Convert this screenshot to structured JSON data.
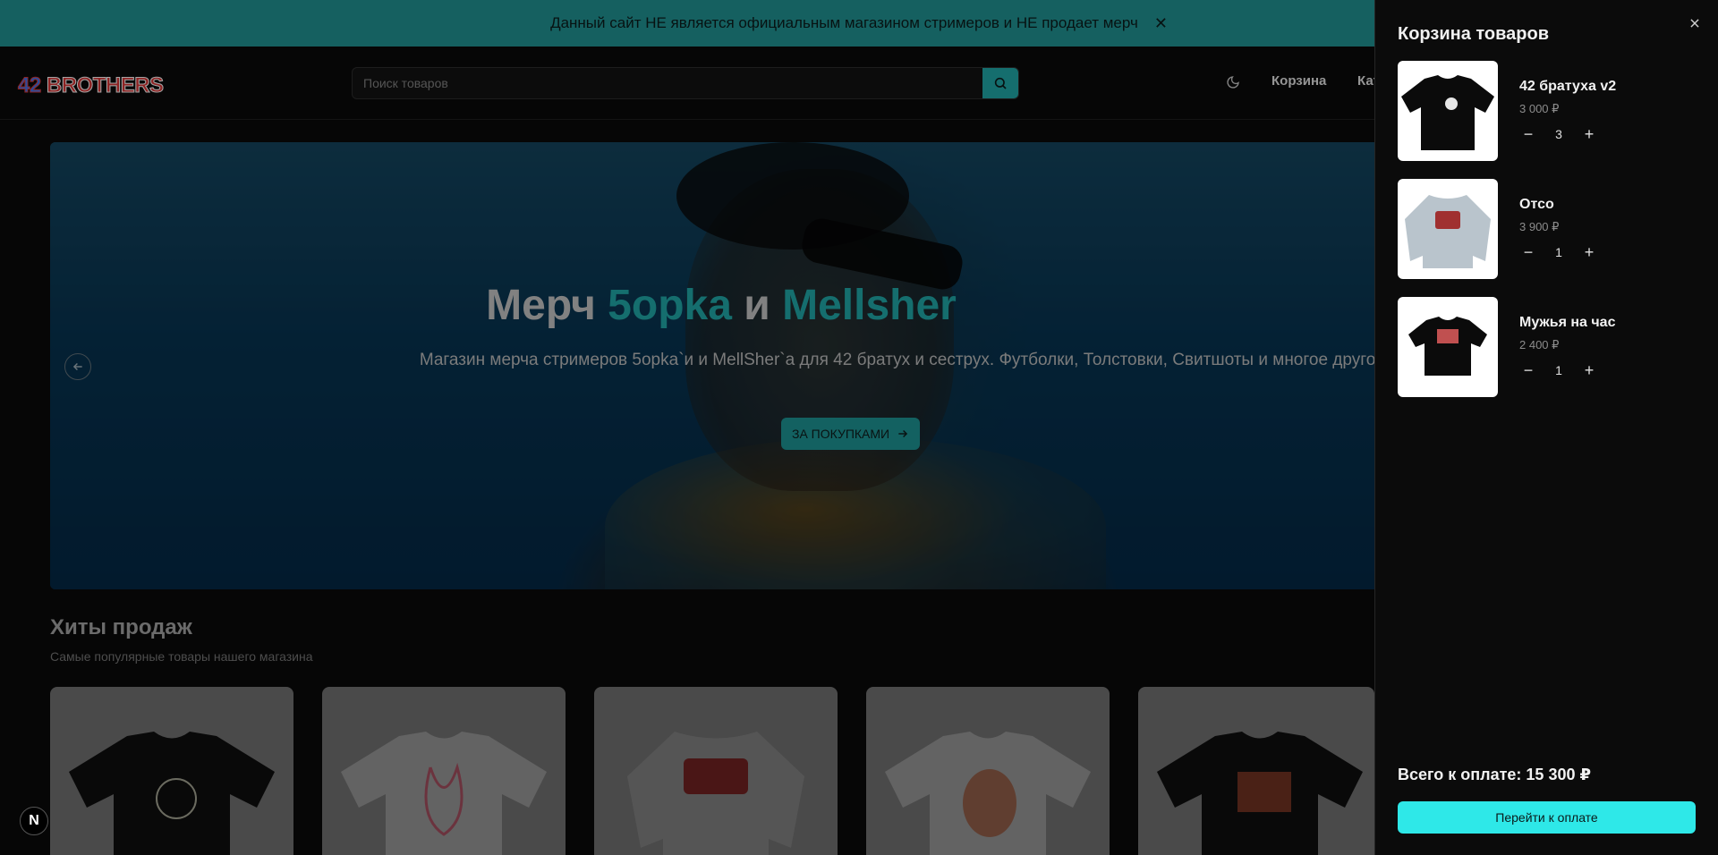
{
  "banner": {
    "text": "Данный сайт НЕ является официальным магазином стримеров и НЕ продает мерч"
  },
  "header": {
    "logo_number": "42",
    "logo_word": "BROTHERS",
    "search_placeholder": "Поиск товаров",
    "nav_cart": "Корзина",
    "nav_catalog_partial": "Кат"
  },
  "hero": {
    "title_part1": "Мерч ",
    "title_acc1": "5opka",
    "title_part2": " и ",
    "title_acc2": "Mellsher",
    "subtitle": "Магазин мерча стримеров 5opka`и и MellSher`a для 42 братух и сеструх. Футболки, Толстовки, Свитшоты и многое другое.",
    "cta": "ЗА ПОКУПКАМИ"
  },
  "section": {
    "title": "Хиты продаж",
    "subtitle": "Самые популярные товары нашего магазина"
  },
  "cart": {
    "title": "Корзина товаров",
    "items": [
      {
        "name": "42 братуха v2",
        "price": "3 000 ₽",
        "qty": "3"
      },
      {
        "name": "Отсо",
        "price": "3 900 ₽",
        "qty": "1"
      },
      {
        "name": "Мужья на час",
        "price": "2 400 ₽",
        "qty": "1"
      }
    ],
    "total": "Всего к оплате: 15 300 ₽",
    "checkout": "Перейти к оплате"
  },
  "badge": {
    "letter": "N"
  },
  "colors": {
    "accent": "#1f9e9e",
    "checkout": "#2ee8e8",
    "banner": "#1f8a8a"
  }
}
